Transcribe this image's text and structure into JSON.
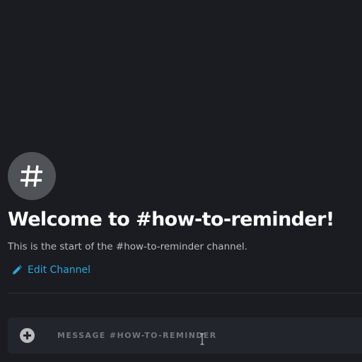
{
  "channel": {
    "avatar_icon": "hash-icon",
    "welcome_title": "Welcome to #how-to-reminder!",
    "welcome_subtitle": "This is the start of the #how-to-reminder channel.",
    "edit_channel_label": "Edit Channel",
    "edit_channel_icon": "pencil-icon"
  },
  "composer": {
    "attach_icon": "plus-circle-icon",
    "placeholder": "MESSAGE #HOW-TO-REMINDER",
    "value": ""
  },
  "colors": {
    "background": "#1a1c21",
    "avatar_bg": "#4f5257",
    "title": "#ffffff",
    "subtitle": "#b9bbbe",
    "link": "#2fa5dc",
    "composer_bg": "#22252b",
    "placeholder": "#72767d"
  }
}
